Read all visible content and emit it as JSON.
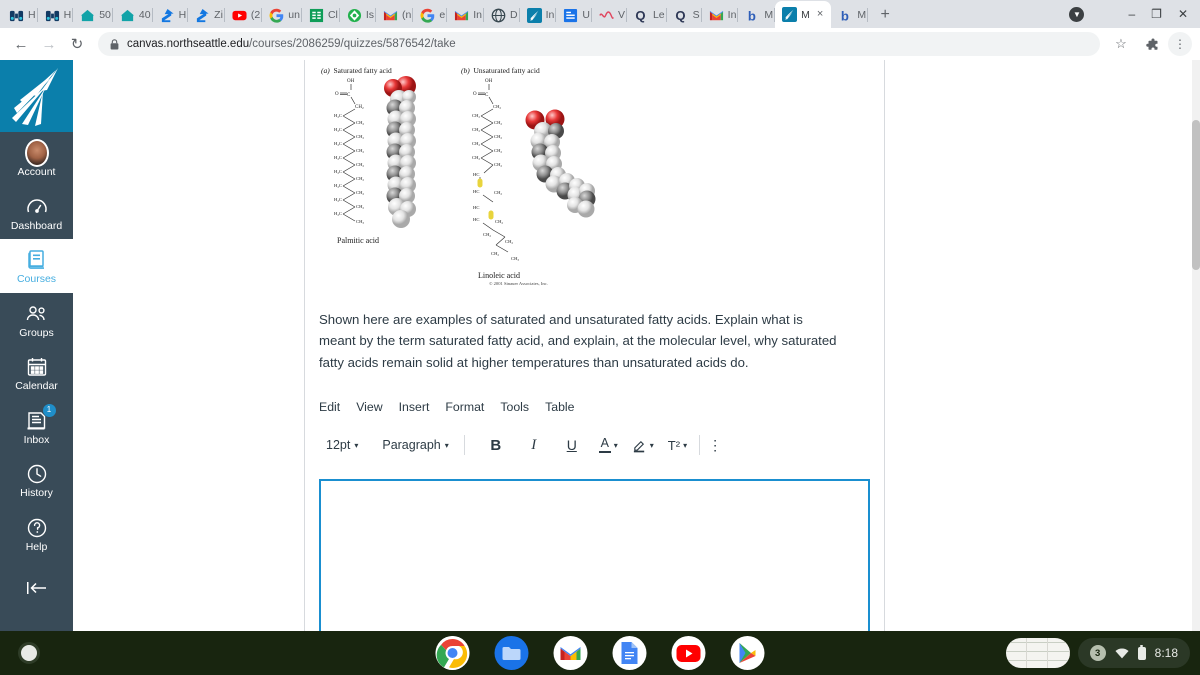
{
  "browser": {
    "tabs": [
      {
        "label": "H",
        "icon": "binoculars-icon",
        "active": false
      },
      {
        "label": "H",
        "icon": "binoculars-icon",
        "active": false
      },
      {
        "label": "50",
        "icon": "home-teal-icon",
        "active": false
      },
      {
        "label": "40",
        "icon": "home-teal-icon",
        "active": false
      },
      {
        "label": "H",
        "icon": "zillow-icon",
        "active": false
      },
      {
        "label": "Zi",
        "icon": "zillow-icon",
        "active": false
      },
      {
        "label": "(2",
        "icon": "youtube-icon",
        "active": false
      },
      {
        "label": "un",
        "icon": "google-icon",
        "active": false
      },
      {
        "label": "Cl",
        "icon": "sheets-icon",
        "active": false
      },
      {
        "label": "Is",
        "icon": "unity-icon",
        "active": false
      },
      {
        "label": "(n",
        "icon": "gmail-icon",
        "active": false
      },
      {
        "label": "e",
        "icon": "google-icon",
        "active": false
      },
      {
        "label": "In",
        "icon": "gmail-icon",
        "active": false
      },
      {
        "label": "D",
        "icon": "globe-icon",
        "active": false
      },
      {
        "label": "In",
        "icon": "canvas-icon",
        "active": false
      },
      {
        "label": "U",
        "icon": "doc-blue-icon",
        "active": false
      },
      {
        "label": "V",
        "icon": "squiggle-red-icon",
        "active": false
      },
      {
        "label": "Le",
        "icon": "quizlet-icon",
        "active": false
      },
      {
        "label": "S",
        "icon": "quizlet-icon",
        "active": false
      },
      {
        "label": "In",
        "icon": "gmail-icon",
        "active": false
      },
      {
        "label": "M",
        "icon": "brainly-icon",
        "active": false
      },
      {
        "label": "M",
        "icon": "canvas-icon",
        "active": true
      },
      {
        "label": "M",
        "icon": "brainly-icon",
        "active": false
      }
    ],
    "newtab_label": "+",
    "tab_close_label": "×",
    "window_controls": {
      "download_label": "⬇",
      "minimize_label": "–",
      "maximize_label": "❐",
      "close_label": "✕"
    },
    "nav": {
      "back_label": "←",
      "forward_label": "→",
      "reload_label": "↻",
      "bookmark_label": "☆",
      "extensions_label": "extensions",
      "menu_label": "⋮"
    },
    "address": {
      "lock_label": "🔒",
      "host": "canvas.northseattle.edu",
      "path": "/courses/2086259/quizzes/5876542/take"
    }
  },
  "global_nav": {
    "logo_name": "north-seattle-college-logo",
    "items": [
      {
        "label": "Account",
        "icon": "user-avatar-icon",
        "active": false,
        "badge": ""
      },
      {
        "label": "Dashboard",
        "icon": "dashboard-gauge-icon",
        "active": false,
        "badge": ""
      },
      {
        "label": "Courses",
        "icon": "courses-book-icon",
        "active": true,
        "badge": ""
      },
      {
        "label": "Groups",
        "icon": "groups-people-icon",
        "active": false,
        "badge": ""
      },
      {
        "label": "Calendar",
        "icon": "calendar-icon",
        "active": false,
        "badge": ""
      },
      {
        "label": "Inbox",
        "icon": "inbox-tray-icon",
        "active": false,
        "badge": "1"
      },
      {
        "label": "History",
        "icon": "history-clock-icon",
        "active": false,
        "badge": ""
      },
      {
        "label": "Help",
        "icon": "help-question-icon",
        "active": false,
        "badge": ""
      }
    ],
    "collapse_label": "⇤"
  },
  "quiz": {
    "figure": {
      "panel_a_prefix": "(a)",
      "panel_a_title": "Saturated fatty acid",
      "panel_a_name": "Palmitic acid",
      "panel_b_prefix": "(b)",
      "panel_b_title": "Unsaturated fatty acid",
      "panel_b_name": "Linoleic acid",
      "credit": "© 2001 Sinauer Associates, Inc."
    },
    "question_text": "Shown here are examples of saturated and unsaturated fatty acids. Explain what is meant by the term saturated fatty acid, and explain, at the molecular level, why saturated fatty acids remain solid at higher temperatures than unsaturated acids do.",
    "editor": {
      "menus": [
        "Edit",
        "View",
        "Insert",
        "Format",
        "Tools",
        "Table"
      ],
      "font_size": "12pt",
      "block_format": "Paragraph",
      "bold_label": "B",
      "italic_label": "I",
      "underline_label": "U",
      "text_color_label": "A",
      "highlight_label": "✎",
      "superscript_label": "T²",
      "more_label": "⋮",
      "chevron_label": "⌄"
    },
    "answer_value": "",
    "answer_placeholder": ""
  },
  "shelf": {
    "launcher_label": "launcher",
    "apps": [
      {
        "name": "chrome-icon",
        "running": true
      },
      {
        "name": "files-icon",
        "running": false
      },
      {
        "name": "gmail-icon",
        "running": false
      },
      {
        "name": "google-docs-icon",
        "running": true
      },
      {
        "name": "youtube-icon",
        "running": false
      },
      {
        "name": "play-store-icon",
        "running": false
      }
    ],
    "status": {
      "notification_count": "3",
      "wifi_label": "wifi",
      "battery_label": "battery",
      "time": "8:18"
    }
  }
}
